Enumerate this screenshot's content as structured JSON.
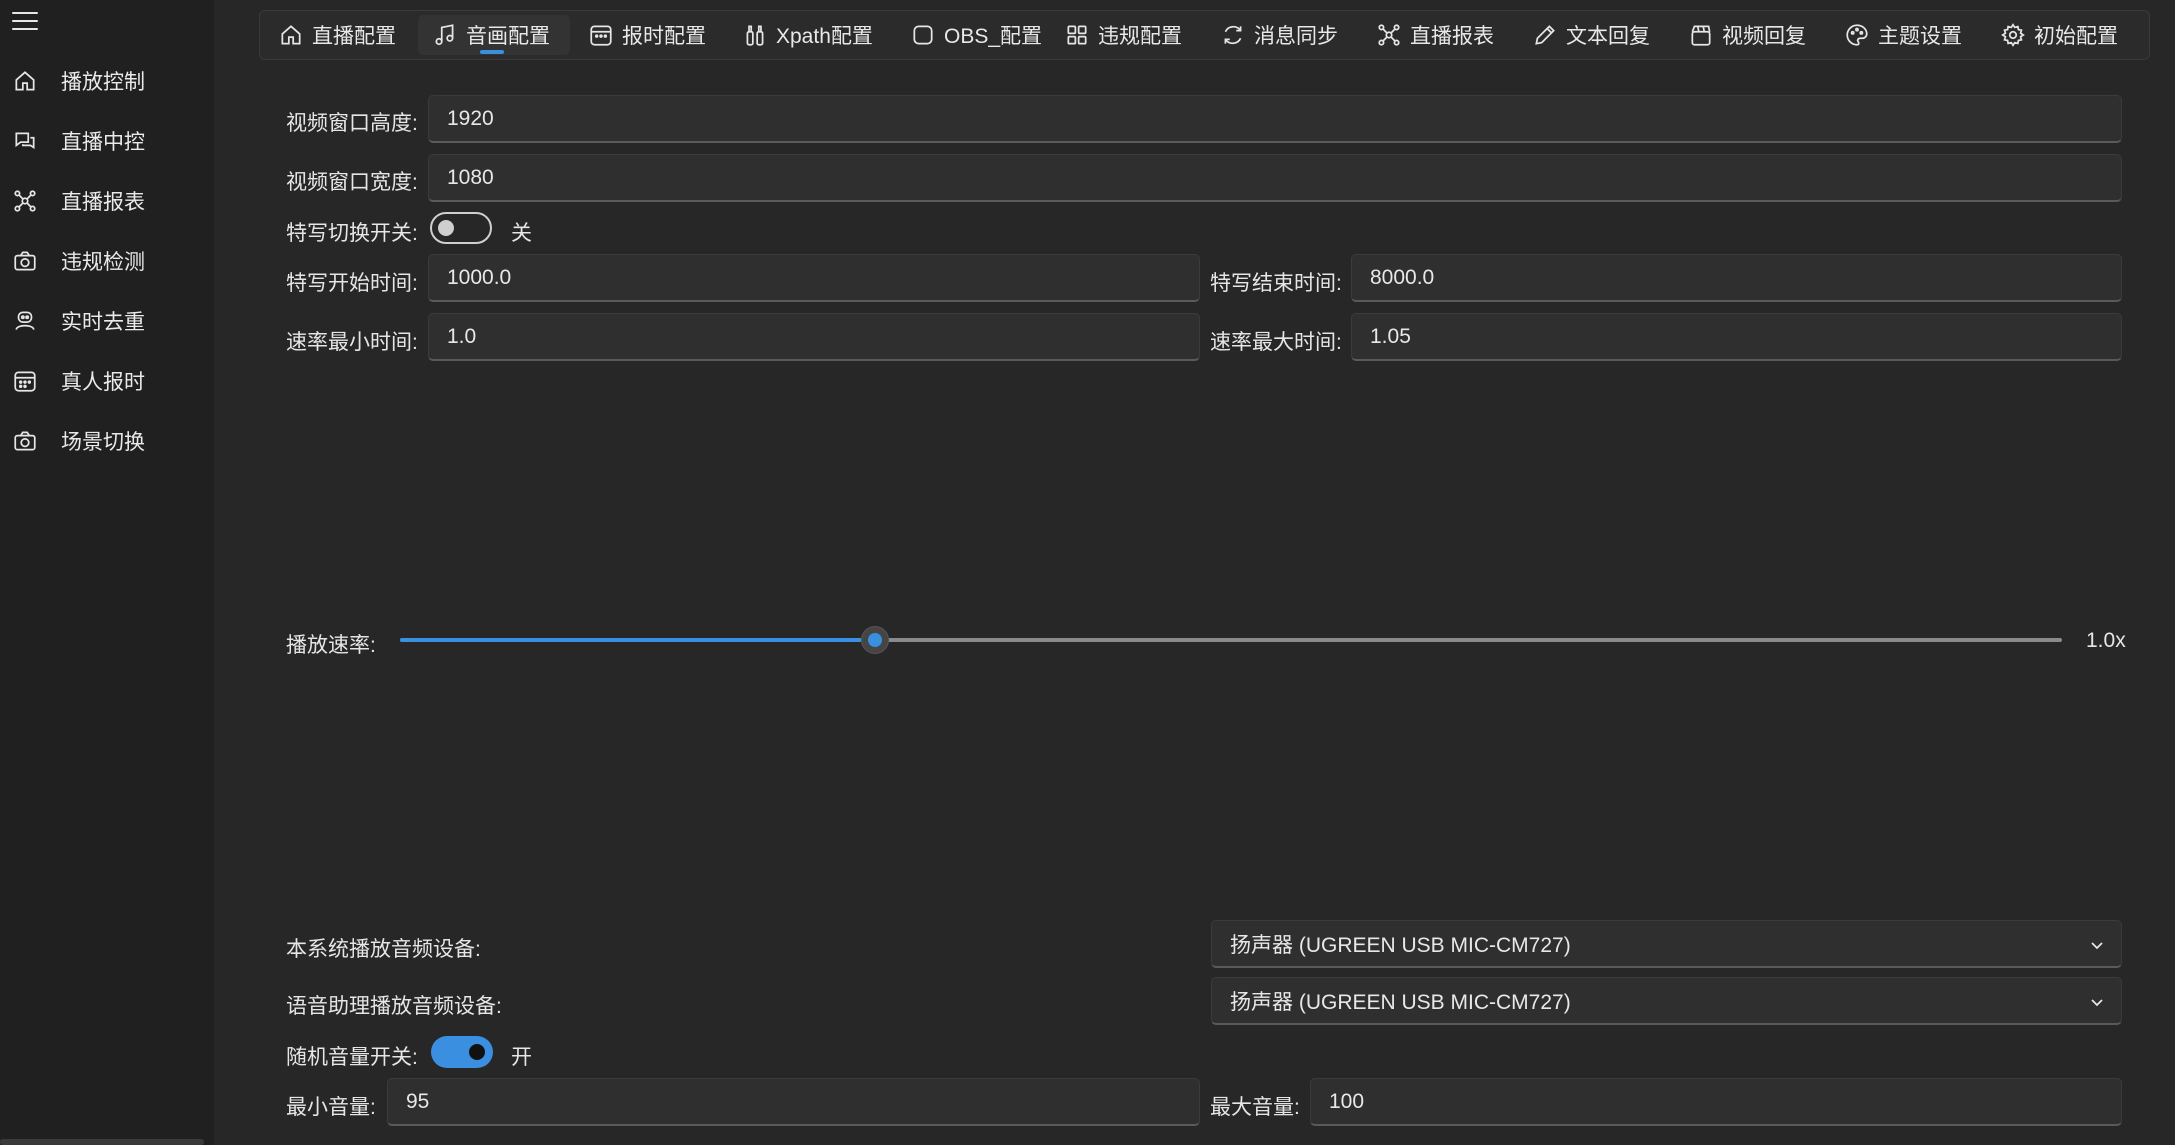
{
  "sidebar": {
    "menu_icon": "hamburger-menu-icon",
    "items": [
      {
        "label": "播放控制",
        "icon": "home-icon"
      },
      {
        "label": "直播中控",
        "icon": "chat-bubbles-icon"
      },
      {
        "label": "直播报表",
        "icon": "network-nodes-icon"
      },
      {
        "label": "违规检测",
        "icon": "camera-icon"
      },
      {
        "label": "实时去重",
        "icon": "robot-icon"
      },
      {
        "label": "真人报时",
        "icon": "calendar-icon"
      },
      {
        "label": "场景切换",
        "icon": "camera-icon"
      }
    ]
  },
  "tabs": [
    {
      "label": "直播配置",
      "icon": "home-icon"
    },
    {
      "label": "音画配置",
      "icon": "music-note-icon",
      "active": true
    },
    {
      "label": "报时配置",
      "icon": "calendar-icon"
    },
    {
      "label": "Xpath配置",
      "icon": "bottles-icon"
    },
    {
      "label": "OBS_配置",
      "icon": "square-icon"
    },
    {
      "label": "违规配置",
      "icon": "grid-apps-icon"
    },
    {
      "label": "消息同步",
      "icon": "sync-icon"
    },
    {
      "label": "直播报表",
      "icon": "network-nodes-icon"
    },
    {
      "label": "文本回复",
      "icon": "pencil-icon"
    },
    {
      "label": "视频回复",
      "icon": "clapperboard-icon"
    },
    {
      "label": "主题设置",
      "icon": "palette-icon"
    },
    {
      "label": "初始配置",
      "icon": "gear-icon"
    }
  ],
  "form": {
    "video_height": {
      "label": "视频窗口高度:",
      "value": "1920"
    },
    "video_width": {
      "label": "视频窗口宽度:",
      "value": "1080"
    },
    "closeup_switch": {
      "label": "特写切换开关:",
      "state": "关",
      "on": false
    },
    "closeup_start": {
      "label": "特写开始时间:",
      "value": "1000.0"
    },
    "closeup_end": {
      "label": "特写结束时间:",
      "value": "8000.0"
    },
    "rate_min": {
      "label": "速率最小时间:",
      "value": "1.0"
    },
    "rate_max": {
      "label": "速率最大时间:",
      "value": "1.05"
    },
    "playback_rate": {
      "label": "播放速率:",
      "value_text": "1.0x",
      "fraction": 0.286
    },
    "system_audio_device": {
      "label": "本系统播放音频设备:",
      "value": "扬声器 (UGREEN USB MIC-CM727)"
    },
    "assistant_audio_device": {
      "label": "语音助理播放音频设备:",
      "value": "扬声器 (UGREEN USB MIC-CM727)"
    },
    "random_volume_switch": {
      "label": "随机音量开关:",
      "state": "开",
      "on": true
    },
    "min_volume": {
      "label": "最小音量:",
      "value": "95"
    },
    "max_volume": {
      "label": "最大音量:",
      "value": "100"
    }
  },
  "colors": {
    "accent": "#3a8fe0",
    "background": "#272727",
    "sidebar": "#202020"
  }
}
